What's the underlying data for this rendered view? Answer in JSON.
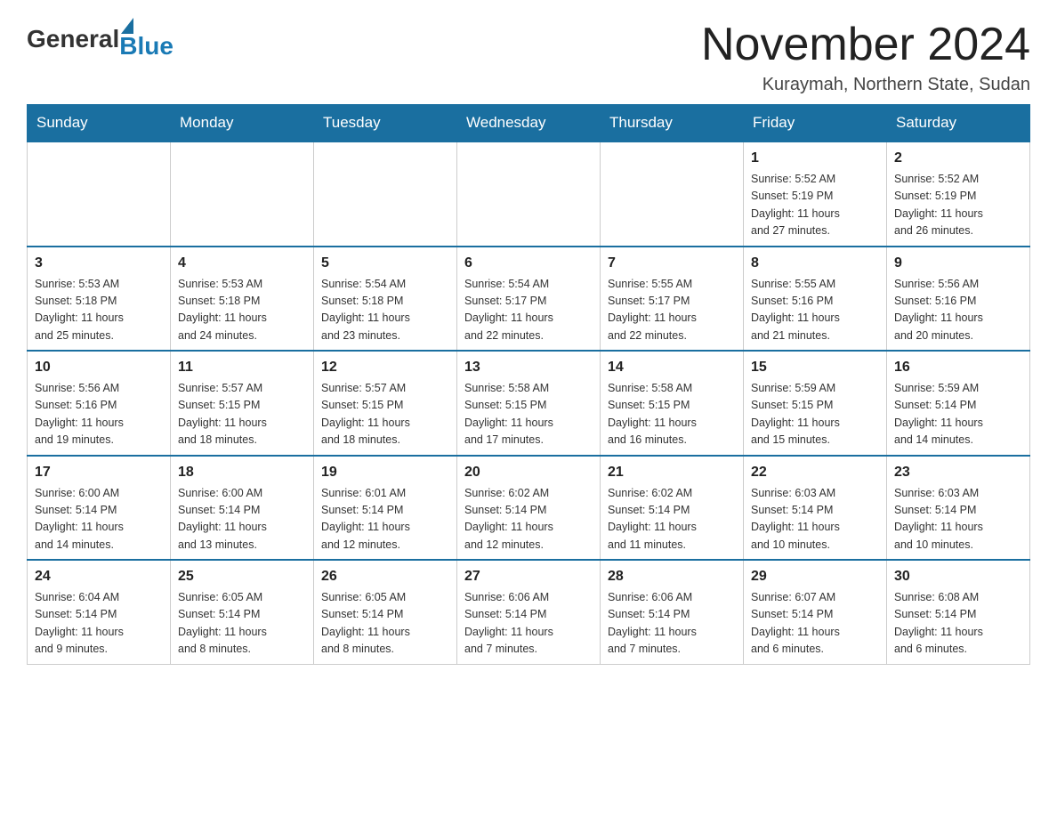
{
  "logo": {
    "general": "General",
    "blue": "Blue"
  },
  "title": "November 2024",
  "subtitle": "Kuraymah, Northern State, Sudan",
  "days_header": [
    "Sunday",
    "Monday",
    "Tuesday",
    "Wednesday",
    "Thursday",
    "Friday",
    "Saturday"
  ],
  "weeks": [
    [
      {
        "day": "",
        "info": ""
      },
      {
        "day": "",
        "info": ""
      },
      {
        "day": "",
        "info": ""
      },
      {
        "day": "",
        "info": ""
      },
      {
        "day": "",
        "info": ""
      },
      {
        "day": "1",
        "info": "Sunrise: 5:52 AM\nSunset: 5:19 PM\nDaylight: 11 hours\nand 27 minutes."
      },
      {
        "day": "2",
        "info": "Sunrise: 5:52 AM\nSunset: 5:19 PM\nDaylight: 11 hours\nand 26 minutes."
      }
    ],
    [
      {
        "day": "3",
        "info": "Sunrise: 5:53 AM\nSunset: 5:18 PM\nDaylight: 11 hours\nand 25 minutes."
      },
      {
        "day": "4",
        "info": "Sunrise: 5:53 AM\nSunset: 5:18 PM\nDaylight: 11 hours\nand 24 minutes."
      },
      {
        "day": "5",
        "info": "Sunrise: 5:54 AM\nSunset: 5:18 PM\nDaylight: 11 hours\nand 23 minutes."
      },
      {
        "day": "6",
        "info": "Sunrise: 5:54 AM\nSunset: 5:17 PM\nDaylight: 11 hours\nand 22 minutes."
      },
      {
        "day": "7",
        "info": "Sunrise: 5:55 AM\nSunset: 5:17 PM\nDaylight: 11 hours\nand 22 minutes."
      },
      {
        "day": "8",
        "info": "Sunrise: 5:55 AM\nSunset: 5:16 PM\nDaylight: 11 hours\nand 21 minutes."
      },
      {
        "day": "9",
        "info": "Sunrise: 5:56 AM\nSunset: 5:16 PM\nDaylight: 11 hours\nand 20 minutes."
      }
    ],
    [
      {
        "day": "10",
        "info": "Sunrise: 5:56 AM\nSunset: 5:16 PM\nDaylight: 11 hours\nand 19 minutes."
      },
      {
        "day": "11",
        "info": "Sunrise: 5:57 AM\nSunset: 5:15 PM\nDaylight: 11 hours\nand 18 minutes."
      },
      {
        "day": "12",
        "info": "Sunrise: 5:57 AM\nSunset: 5:15 PM\nDaylight: 11 hours\nand 18 minutes."
      },
      {
        "day": "13",
        "info": "Sunrise: 5:58 AM\nSunset: 5:15 PM\nDaylight: 11 hours\nand 17 minutes."
      },
      {
        "day": "14",
        "info": "Sunrise: 5:58 AM\nSunset: 5:15 PM\nDaylight: 11 hours\nand 16 minutes."
      },
      {
        "day": "15",
        "info": "Sunrise: 5:59 AM\nSunset: 5:15 PM\nDaylight: 11 hours\nand 15 minutes."
      },
      {
        "day": "16",
        "info": "Sunrise: 5:59 AM\nSunset: 5:14 PM\nDaylight: 11 hours\nand 14 minutes."
      }
    ],
    [
      {
        "day": "17",
        "info": "Sunrise: 6:00 AM\nSunset: 5:14 PM\nDaylight: 11 hours\nand 14 minutes."
      },
      {
        "day": "18",
        "info": "Sunrise: 6:00 AM\nSunset: 5:14 PM\nDaylight: 11 hours\nand 13 minutes."
      },
      {
        "day": "19",
        "info": "Sunrise: 6:01 AM\nSunset: 5:14 PM\nDaylight: 11 hours\nand 12 minutes."
      },
      {
        "day": "20",
        "info": "Sunrise: 6:02 AM\nSunset: 5:14 PM\nDaylight: 11 hours\nand 12 minutes."
      },
      {
        "day": "21",
        "info": "Sunrise: 6:02 AM\nSunset: 5:14 PM\nDaylight: 11 hours\nand 11 minutes."
      },
      {
        "day": "22",
        "info": "Sunrise: 6:03 AM\nSunset: 5:14 PM\nDaylight: 11 hours\nand 10 minutes."
      },
      {
        "day": "23",
        "info": "Sunrise: 6:03 AM\nSunset: 5:14 PM\nDaylight: 11 hours\nand 10 minutes."
      }
    ],
    [
      {
        "day": "24",
        "info": "Sunrise: 6:04 AM\nSunset: 5:14 PM\nDaylight: 11 hours\nand 9 minutes."
      },
      {
        "day": "25",
        "info": "Sunrise: 6:05 AM\nSunset: 5:14 PM\nDaylight: 11 hours\nand 8 minutes."
      },
      {
        "day": "26",
        "info": "Sunrise: 6:05 AM\nSunset: 5:14 PM\nDaylight: 11 hours\nand 8 minutes."
      },
      {
        "day": "27",
        "info": "Sunrise: 6:06 AM\nSunset: 5:14 PM\nDaylight: 11 hours\nand 7 minutes."
      },
      {
        "day": "28",
        "info": "Sunrise: 6:06 AM\nSunset: 5:14 PM\nDaylight: 11 hours\nand 7 minutes."
      },
      {
        "day": "29",
        "info": "Sunrise: 6:07 AM\nSunset: 5:14 PM\nDaylight: 11 hours\nand 6 minutes."
      },
      {
        "day": "30",
        "info": "Sunrise: 6:08 AM\nSunset: 5:14 PM\nDaylight: 11 hours\nand 6 minutes."
      }
    ]
  ]
}
